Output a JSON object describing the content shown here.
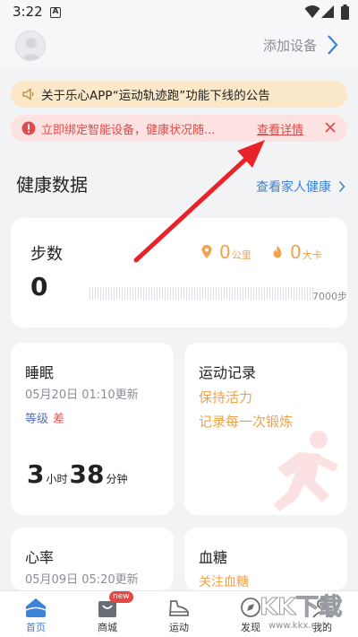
{
  "status_bar": {
    "time": "3:22",
    "notification_letter": "A"
  },
  "header": {
    "add_device_label": "添加设备"
  },
  "notices": {
    "announcement": "关于乐心APP“运动轨迹跑”功能下线的公告",
    "bind_alert": "立即绑定智能设备，健康状况随...",
    "view_details": "查看详情"
  },
  "health": {
    "section_title": "健康数据",
    "family_link": "查看家人健康",
    "steps": {
      "title": "步数",
      "value": "0",
      "distance_value": "0",
      "distance_unit": "公里",
      "calories_value": "0",
      "calories_unit": "大卡",
      "goal": "7000步",
      "progress": 0
    },
    "sleep": {
      "title": "睡眠",
      "updated": "05月20日 01:10更新",
      "level_label": "等级",
      "level_value": "差",
      "hours": "3",
      "hours_unit": "小时",
      "minutes": "38",
      "minutes_unit": "分钟"
    },
    "exercise": {
      "title": "运动记录",
      "line1": "保持活力",
      "line2": "记录每一次锻炼"
    },
    "heart_rate": {
      "title": "心率",
      "updated": "05月09日 05:20更新"
    },
    "blood_sugar": {
      "title": "血糖",
      "line1": "关注血糖"
    }
  },
  "tabs": [
    {
      "label": "首页",
      "icon": "home-icon",
      "active": true
    },
    {
      "label": "商城",
      "icon": "mall-icon",
      "badge": "new"
    },
    {
      "label": "运动",
      "icon": "shoe-icon"
    },
    {
      "label": "发现",
      "icon": "discover-icon"
    },
    {
      "label": "我的",
      "icon": "profile-icon"
    }
  ],
  "watermark": {
    "brand": "KK下载",
    "url": "www.kkx.net"
  },
  "colors": {
    "accent_blue": "#3b82d8",
    "warning_red": "#e04a4a",
    "orange": "#f0a24c",
    "arrow_red": "#e8232a"
  }
}
